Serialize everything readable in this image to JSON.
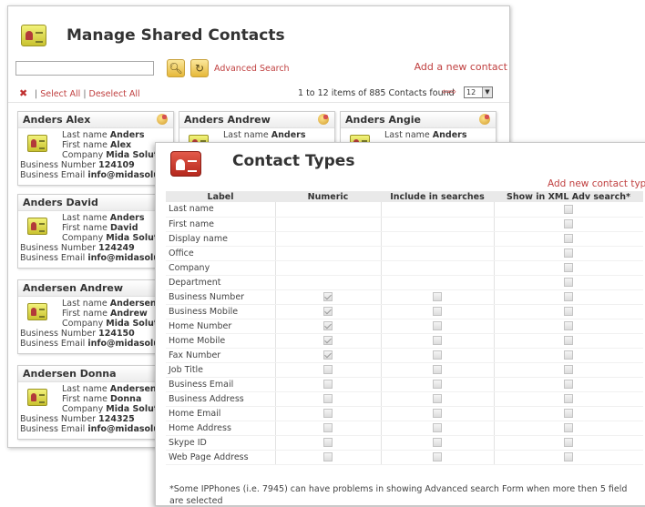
{
  "manage": {
    "title": "Manage Shared Contacts",
    "search_value": "",
    "advanced_search": "Advanced Search",
    "add_contact": "Add a new contact",
    "select_all": "Select All",
    "deselect_all": "Deselect All",
    "sep": "|",
    "items_count": "1 to 12 items of 885 Contacts found",
    "page_size": "12",
    "cards": [
      {
        "name": "Anders Alex",
        "last": "Anders",
        "first": "Alex",
        "company": "Mida Solutions",
        "number": "124109",
        "email": "info@midasolution"
      },
      {
        "name": "Anders Andrew",
        "last": "Anders",
        "first": "",
        "company": "",
        "number": "",
        "email": ""
      },
      {
        "name": "Anders Angie",
        "last": "Anders",
        "first": "",
        "company": "",
        "number": "",
        "email": ""
      },
      {
        "name": "Anders David",
        "last": "Anders",
        "first": "David",
        "company": "Mida Solutions",
        "number": "124249",
        "email": "info@midasolution"
      },
      {
        "name": "Andersen Andrew",
        "last": "Andersen",
        "first": "Andrew",
        "company": "Mida Solutions",
        "number": "124150",
        "email": "info@midasolution"
      },
      {
        "name": "Andersen Donna",
        "last": "Andersen",
        "first": "Donna",
        "company": "Mida Solutions",
        "number": "124325",
        "email": "info@midasolution"
      }
    ],
    "labels": {
      "last": "Last name",
      "first": "First name",
      "company": "Company",
      "number": "Business Number",
      "email": "Business Email"
    }
  },
  "contact_types": {
    "title": "Contact Types",
    "add_link": "Add new contact type",
    "columns": [
      "Label",
      "Numeric",
      "Include in searches",
      "Show in XML Adv search*"
    ],
    "rows": [
      {
        "label": "Last name",
        "numeric": null,
        "include": null,
        "show": false
      },
      {
        "label": "First name",
        "numeric": null,
        "include": null,
        "show": false
      },
      {
        "label": "Display name",
        "numeric": null,
        "include": null,
        "show": false
      },
      {
        "label": "Office",
        "numeric": null,
        "include": null,
        "show": false
      },
      {
        "label": "Company",
        "numeric": null,
        "include": null,
        "show": false
      },
      {
        "label": "Department",
        "numeric": null,
        "include": null,
        "show": false
      },
      {
        "label": "Business Number",
        "numeric": true,
        "include": false,
        "show": false
      },
      {
        "label": "Business Mobile",
        "numeric": true,
        "include": false,
        "show": false
      },
      {
        "label": "Home Number",
        "numeric": true,
        "include": false,
        "show": false
      },
      {
        "label": "Home Mobile",
        "numeric": true,
        "include": false,
        "show": false
      },
      {
        "label": "Fax Number",
        "numeric": true,
        "include": false,
        "show": false
      },
      {
        "label": "Job Title",
        "numeric": false,
        "include": false,
        "show": false
      },
      {
        "label": "Business Email",
        "numeric": false,
        "include": false,
        "show": false
      },
      {
        "label": "Business Address",
        "numeric": false,
        "include": false,
        "show": false
      },
      {
        "label": "Home Email",
        "numeric": false,
        "include": false,
        "show": false
      },
      {
        "label": "Home Address",
        "numeric": false,
        "include": false,
        "show": false
      },
      {
        "label": "Skype ID",
        "numeric": false,
        "include": false,
        "show": false
      },
      {
        "label": "Web Page Address",
        "numeric": false,
        "include": false,
        "show": false
      }
    ],
    "note": "*Some IPPhones (i.e. 7945) can have problems in showing Advanced search Form when more then 5 field are selected"
  }
}
